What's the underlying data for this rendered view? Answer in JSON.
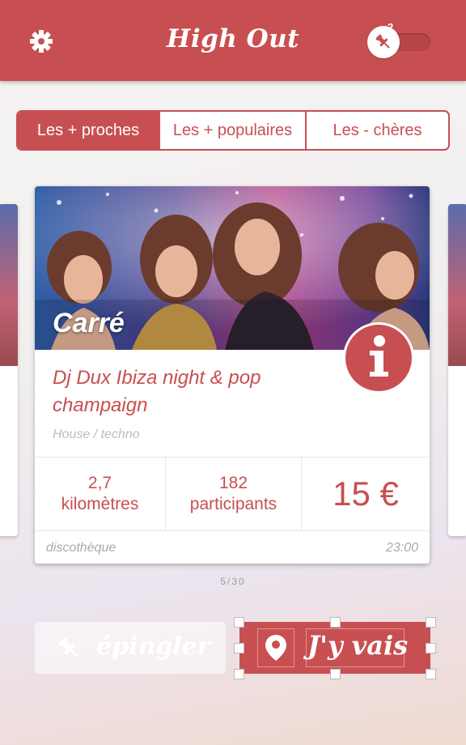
{
  "header": {
    "title": "High Out",
    "settings_icon": "gear-icon",
    "pinned_icon": "pin-icon",
    "pinned_count": "2",
    "accent_color": "#c84f51"
  },
  "filters": {
    "tabs": [
      {
        "label": "Les + proches",
        "active": true
      },
      {
        "label": "Les + populaires",
        "active": false
      },
      {
        "label": "Les - chères",
        "active": false
      }
    ]
  },
  "card": {
    "venue": "Carré",
    "title": "Dj Dux Ibiza night & pop champaign",
    "genre": "House / techno",
    "distance_value": "2,7",
    "distance_unit": "kilomètres",
    "participants_value": "182",
    "participants_unit": "participants",
    "price": "15 €",
    "category": "discothèque",
    "time": "23:00",
    "info_icon": "info-icon"
  },
  "pager": "5/30",
  "actions": {
    "pin_label": "épingler",
    "go_label": "J'y vais",
    "pin_icon": "pushpin-icon",
    "go_icon": "location-pin-icon"
  }
}
